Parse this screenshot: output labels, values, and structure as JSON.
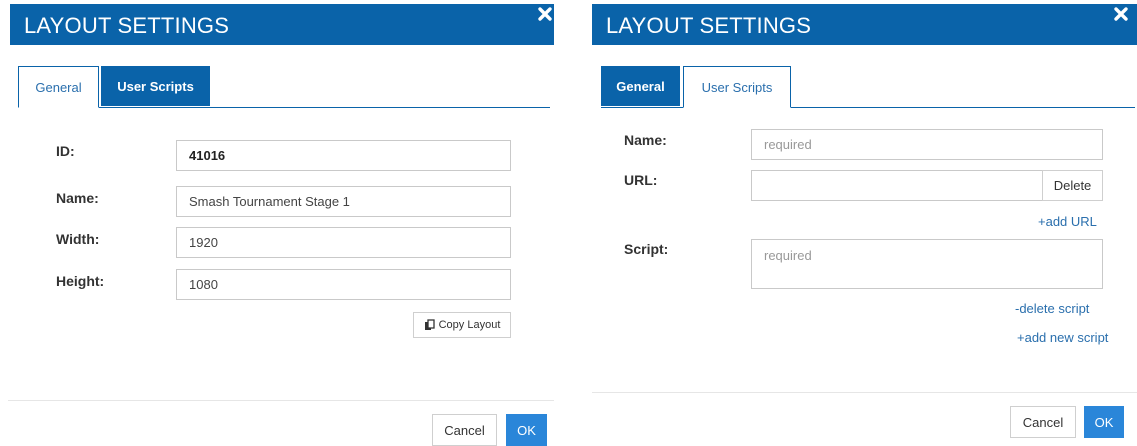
{
  "left_dialog": {
    "title": "LAYOUT SETTINGS",
    "tabs": [
      {
        "label": "General",
        "active": true
      },
      {
        "label": "User Scripts",
        "active": false
      }
    ],
    "fields": {
      "id": {
        "label": "ID:",
        "value": "41016"
      },
      "name": {
        "label": "Name:",
        "value": "Smash Tournament Stage 1"
      },
      "width": {
        "label": "Width:",
        "value": "1920"
      },
      "height": {
        "label": "Height:",
        "value": "1080"
      }
    },
    "copy_layout_label": "Copy Layout",
    "cancel_label": "Cancel",
    "ok_label": "OK"
  },
  "right_dialog": {
    "title": "LAYOUT SETTINGS",
    "tabs": [
      {
        "label": "General",
        "active": false
      },
      {
        "label": "User Scripts",
        "active": true
      }
    ],
    "fields": {
      "name": {
        "label": "Name:",
        "placeholder": "required"
      },
      "url": {
        "label": "URL:",
        "value": ""
      },
      "script": {
        "label": "Script:",
        "placeholder": "required"
      }
    },
    "delete_label": "Delete",
    "add_url_label": "+add URL",
    "delete_script_label": "-delete script",
    "add_new_script_label": "+add new script",
    "cancel_label": "Cancel",
    "ok_label": "OK"
  },
  "colors": {
    "header_blue": "#0a63a9",
    "primary_button": "#2a86d9",
    "link": "#2a6fad"
  }
}
